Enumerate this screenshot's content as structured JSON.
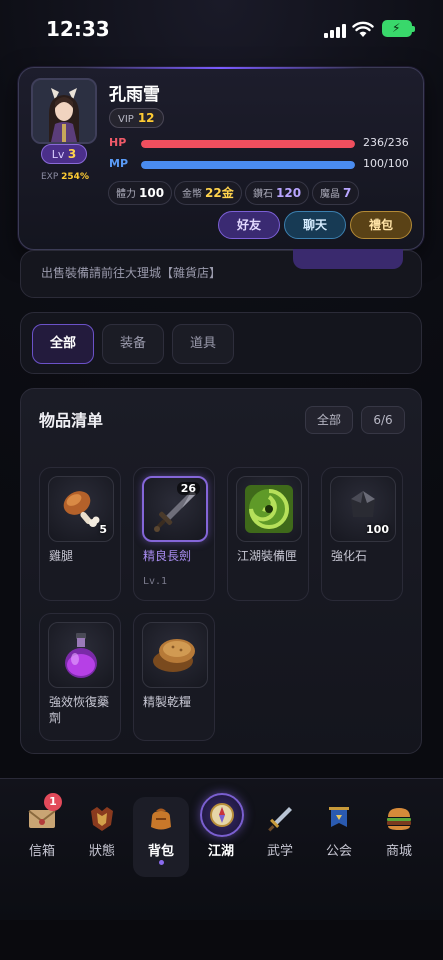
{
  "status_bar": {
    "time": "12:33"
  },
  "profile": {
    "name": "孔雨雪",
    "vip_label": "VIP",
    "vip_level": "12",
    "level_prefix": "Lv",
    "level": "3",
    "exp_label": "EXP",
    "exp_value": "254%",
    "hp": {
      "label": "HP",
      "value": "236/236",
      "fraction": 1.0,
      "color": "#ef4f5e"
    },
    "mp": {
      "label": "MP",
      "value": "100/100",
      "fraction": 1.0,
      "color": "#4a8cf0"
    },
    "resources": [
      {
        "label": "體力",
        "value": "100",
        "color": "#ffffff"
      },
      {
        "label": "金幣",
        "value": "22金",
        "color": "#ffd34d"
      },
      {
        "label": "鑽石",
        "value": "120",
        "color": "#b9a6ff"
      },
      {
        "label": "魔晶",
        "value": "7",
        "color": "#b9a6ff"
      }
    ],
    "buttons": {
      "friends": "好友",
      "chat": "聊天",
      "gift": "禮包"
    }
  },
  "notice": {
    "text": "出售裝備請前往大理城【雜貨店】"
  },
  "filters": {
    "all": "全部",
    "equipment": "装备",
    "items": "道具"
  },
  "inventory": {
    "title": "物品清单",
    "filter_chip": "全部",
    "count": "6/6",
    "items": [
      {
        "name": "雞腿",
        "qty": "5",
        "icon": "drumstick-icon"
      },
      {
        "name": "精良長劍",
        "qty": "26",
        "sub": "Lv.1",
        "icon": "sword-icon",
        "selected": true
      },
      {
        "name": "江湖裝備匣",
        "qty": "",
        "icon": "swirl-box-icon"
      },
      {
        "name": "強化石",
        "qty": "100",
        "icon": "stone-icon"
      },
      {
        "name": "強效恢復藥劑",
        "qty": "",
        "icon": "potion-icon"
      },
      {
        "name": "精製乾糧",
        "qty": "",
        "icon": "bread-icon"
      }
    ]
  },
  "nav": {
    "items": [
      {
        "label": "信箱",
        "icon": "mail-icon",
        "badge": "1"
      },
      {
        "label": "狀態",
        "icon": "armor-icon"
      },
      {
        "label": "背包",
        "icon": "bag-icon",
        "active": true
      },
      {
        "label": "江湖",
        "icon": "compass-icon"
      },
      {
        "label": "武学",
        "icon": "sword-nav-icon"
      },
      {
        "label": "公会",
        "icon": "banner-icon"
      },
      {
        "label": "商城",
        "icon": "burger-icon"
      }
    ]
  }
}
